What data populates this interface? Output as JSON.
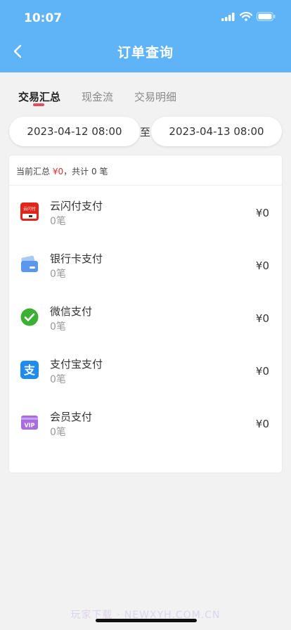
{
  "status_bar": {
    "time": "10:07"
  },
  "nav": {
    "title": "订单查询"
  },
  "tabs": [
    {
      "label": "交易汇总",
      "active": true
    },
    {
      "label": "现金流",
      "active": false
    },
    {
      "label": "交易明细",
      "active": false
    }
  ],
  "date_range": {
    "start": "2023-04-12 08:00",
    "separator": "至",
    "end": "2023-04-13 08:00"
  },
  "summary": {
    "prefix": "当前汇总",
    "amount": "¥0",
    "middle": "，共计",
    "count": "0",
    "suffix": "笔"
  },
  "payments": [
    {
      "name": "云闪付支付",
      "count": "0笔",
      "amount": "¥0",
      "icon": "unionpay-icon"
    },
    {
      "name": "银行卡支付",
      "count": "0笔",
      "amount": "¥0",
      "icon": "bank-card-icon"
    },
    {
      "name": "微信支付",
      "count": "0笔",
      "amount": "¥0",
      "icon": "wechat-pay-icon"
    },
    {
      "name": "支付宝支付",
      "count": "0笔",
      "amount": "¥0",
      "icon": "alipay-icon"
    },
    {
      "name": "会员支付",
      "count": "0笔",
      "amount": "¥0",
      "icon": "vip-icon"
    }
  ],
  "icon_text": {
    "unionpay": "云闪付",
    "vip": "VIP",
    "alipay": "支"
  },
  "watermark": "玩家下载 · NEWXYH.COM.CN",
  "colors": {
    "header": "#5fb4f8",
    "tab_indicator": "#e84a5f",
    "amount_red": "#d9302b"
  }
}
